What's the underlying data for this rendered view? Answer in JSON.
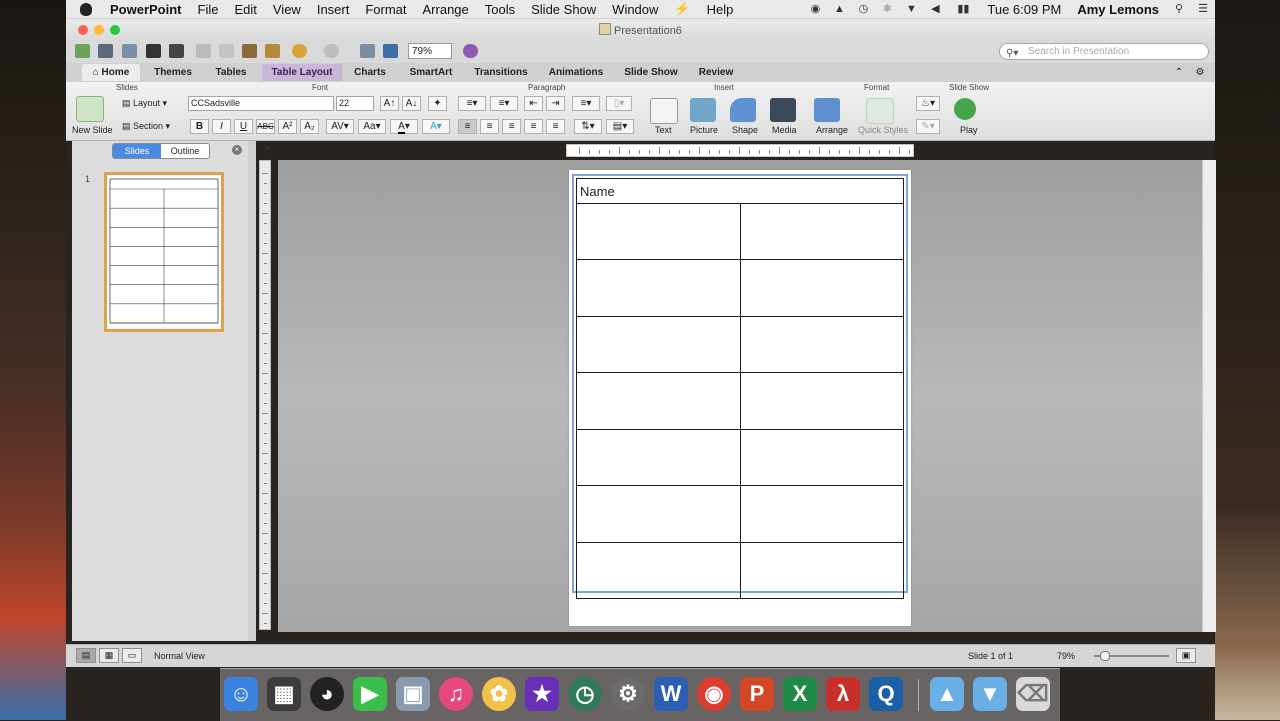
{
  "menubar": {
    "app": "PowerPoint",
    "items": [
      "File",
      "Edit",
      "View",
      "Insert",
      "Format",
      "Arrange",
      "Tools",
      "Slide Show",
      "Window",
      "Help"
    ],
    "time": "Tue 6:09 PM",
    "user": "Amy Lemons"
  },
  "window": {
    "title": "Presentation6"
  },
  "toolbar": {
    "zoom": "79%",
    "search_placeholder": "Search in Presentation"
  },
  "tabs": [
    "Home",
    "Themes",
    "Tables",
    "Table Layout",
    "Charts",
    "SmartArt",
    "Transitions",
    "Animations",
    "Slide Show",
    "Review"
  ],
  "ribbon": {
    "groups": {
      "slides": "Slides",
      "font": "Font",
      "paragraph": "Paragraph",
      "insert": "Insert",
      "format": "Format",
      "slideshow": "Slide Show"
    },
    "new_slide": "New Slide",
    "layout": "Layout",
    "section": "Section",
    "font_name": "CCSadsville",
    "font_size": "22",
    "insert_buttons": [
      "Text",
      "Picture",
      "Shape",
      "Media"
    ],
    "arrange": "Arrange",
    "quick_styles": "Quick Styles",
    "play": "Play"
  },
  "panel": {
    "slides_tab": "Slides",
    "outline_tab": "Outline",
    "thumb_number": "1"
  },
  "slide": {
    "header_text": "Name",
    "rows": 7,
    "cols": 2
  },
  "status": {
    "view_label": "Normal View",
    "slide_of": "Slide 1 of 1",
    "zoom": "79%"
  },
  "colors": {
    "table_layout_tab": "#cbb6d9",
    "selection_frame": "#7fa6d8",
    "thumbnail_border": "#e0a04a"
  }
}
